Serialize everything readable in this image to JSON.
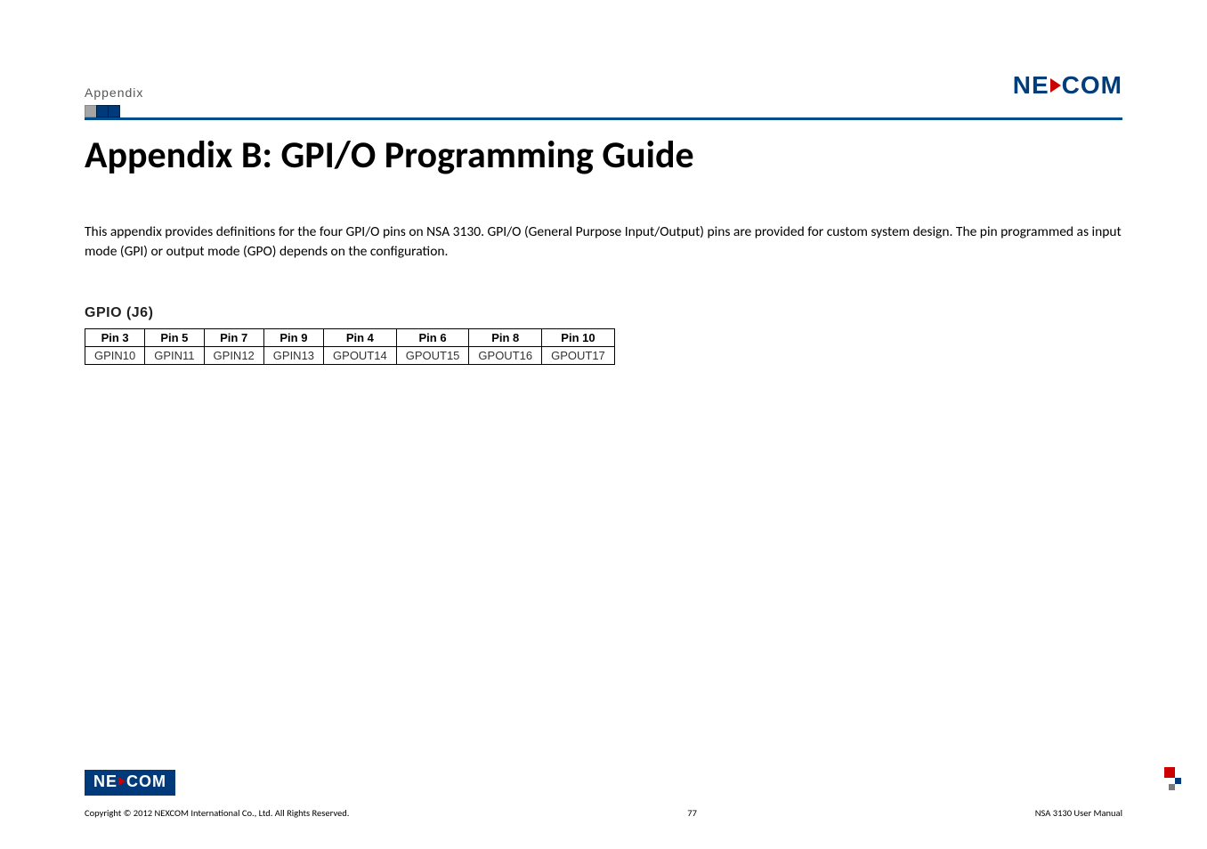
{
  "header": {
    "section_label": "Appendix",
    "logo": {
      "part1": "NE",
      "part2": "COM"
    }
  },
  "title": "Appendix B: GPI/O Programming Guide",
  "intro": "This appendix provides definitions for the four GPI/O pins on NSA 3130. GPI/O (General Purpose Input/Output) pins are provided for custom system design. The pin programmed as input mode (GPI) or output mode (GPO) depends on the configuration.",
  "section": {
    "label": "GPIO (J6)"
  },
  "table": {
    "headers": [
      "Pin 3",
      "Pin 5",
      "Pin 7",
      "Pin 9",
      "Pin 4",
      "Pin 6",
      "Pin 8",
      "Pin 10"
    ],
    "row": [
      "GPIN10",
      "GPIN11",
      "GPIN12",
      "GPIN13",
      "GPOUT14",
      "GPOUT15",
      "GPOUT16",
      "GPOUT17"
    ]
  },
  "footer": {
    "logo": {
      "part1": "NE",
      "part2": "COM"
    },
    "copyright": "Copyright © 2012 NEXCOM International Co., Ltd. All Rights Reserved.",
    "page_number": "77",
    "doc_name": "NSA 3130 User Manual"
  },
  "chart_data": {
    "type": "table",
    "title": "GPIO (J6)",
    "columns": [
      "Pin 3",
      "Pin 5",
      "Pin 7",
      "Pin 9",
      "Pin 4",
      "Pin 6",
      "Pin 8",
      "Pin 10"
    ],
    "rows": [
      [
        "GPIN10",
        "GPIN11",
        "GPIN12",
        "GPIN13",
        "GPOUT14",
        "GPOUT15",
        "GPOUT16",
        "GPOUT17"
      ]
    ]
  }
}
